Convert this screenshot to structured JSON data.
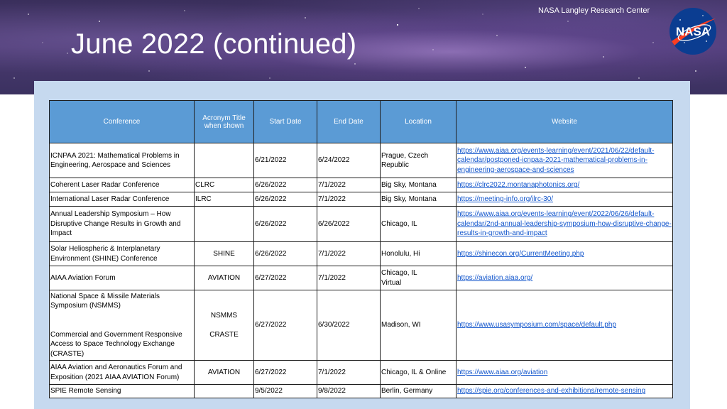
{
  "header": {
    "org": "NASA Langley Research Center",
    "title": "June 2022 (continued)",
    "logo_text": "NASA"
  },
  "table": {
    "headers": [
      "Conference",
      "Acronym Title when shown",
      "Start Date",
      "End Date",
      "Location",
      "Website"
    ],
    "rows": [
      {
        "conference": "ICNPAA 2021: Mathematical Problems in Engineering, Aerospace and Sciences",
        "acronym": "",
        "start": "6/21/2022",
        "end": "6/24/2022",
        "location": "Prague, Czech Republic",
        "website": "https://www.aiaa.org/events-learning/event/2021/06/22/default-calendar/postponed-icnpaa-2021-mathematical-problems-in-engineering-aerospace-and-sciences"
      },
      {
        "conference": "Coherent Laser Radar Conference",
        "acronym": "CLRC",
        "start": "6/26/2022",
        "end": "7/1/2022",
        "location": "Big Sky, Montana",
        "website": "https://clrc2022.montanaphotonics.org/"
      },
      {
        "conference": "International Laser Radar Conference",
        "acronym": "ILRC",
        "start": "6/26/2022",
        "end": "7/1/2022",
        "location": "Big Sky, Montana",
        "website": "https://meeting-info.org/ilrc-30/"
      },
      {
        "conference": "Annual Leadership Symposium – How Disruptive Change Results in Growth and Impact",
        "acronym": "",
        "start": "6/26/2022",
        "end": "6/26/2022",
        "location": "Chicago, IL",
        "website": "https://www.aiaa.org/events-learning/event/2022/06/26/default-calendar/2nd-annual-leadership-symposium-how-disruptive-change-results-in-growth-and-impact"
      },
      {
        "conference": "Solar Heliospheric & Interplanetary Environment (SHINE) Conference",
        "acronym": "SHINE",
        "start": "6/26/2022",
        "end": "7/1/2022",
        "location": "Honolulu, Hi",
        "website": "https://shinecon.org/CurrentMeeting.php"
      },
      {
        "conference": "AIAA Aviation Forum",
        "acronym": "AVIATION",
        "start": "6/27/2022",
        "end": "7/1/2022",
        "location": "Chicago, IL",
        "location2": "Virtual",
        "website": "https://aviation.aiaa.org/"
      },
      {
        "conference": "National Space & Missile Materials Symposium (NSMMS)",
        "conference2": "Commercial and Government Responsive Access to Space Technology Exchange (CRASTE)",
        "acronym": "NSMMS",
        "acronym2": "CRASTE",
        "start": "6/27/2022",
        "end": "6/30/2022",
        "location": "Madison, WI",
        "website": "https://www.usasymposium.com/space/default.php"
      },
      {
        "conference": "AIAA Aviation and Aeronautics Forum and Exposition (2021 AIAA AVIATION Forum)",
        "acronym": "AVIATION",
        "start": "6/27/2022",
        "end": "7/1/2022",
        "location": "Chicago, IL & Online",
        "website": "https://www.aiaa.org/aviation"
      },
      {
        "conference": "SPIE Remote Sensing",
        "acronym": "",
        "start": "9/5/2022",
        "end": "9/8/2022",
        "location": "Berlin, Germany",
        "website": "https://spie.org/conferences-and-exhibitions/remote-sensing"
      }
    ]
  },
  "colors": {
    "header_fill": "#5b9bd5",
    "panel": "#c6d9ef",
    "link": "#1155cc",
    "nasa_blue": "#0b3d91",
    "nasa_red": "#fc3d21"
  }
}
